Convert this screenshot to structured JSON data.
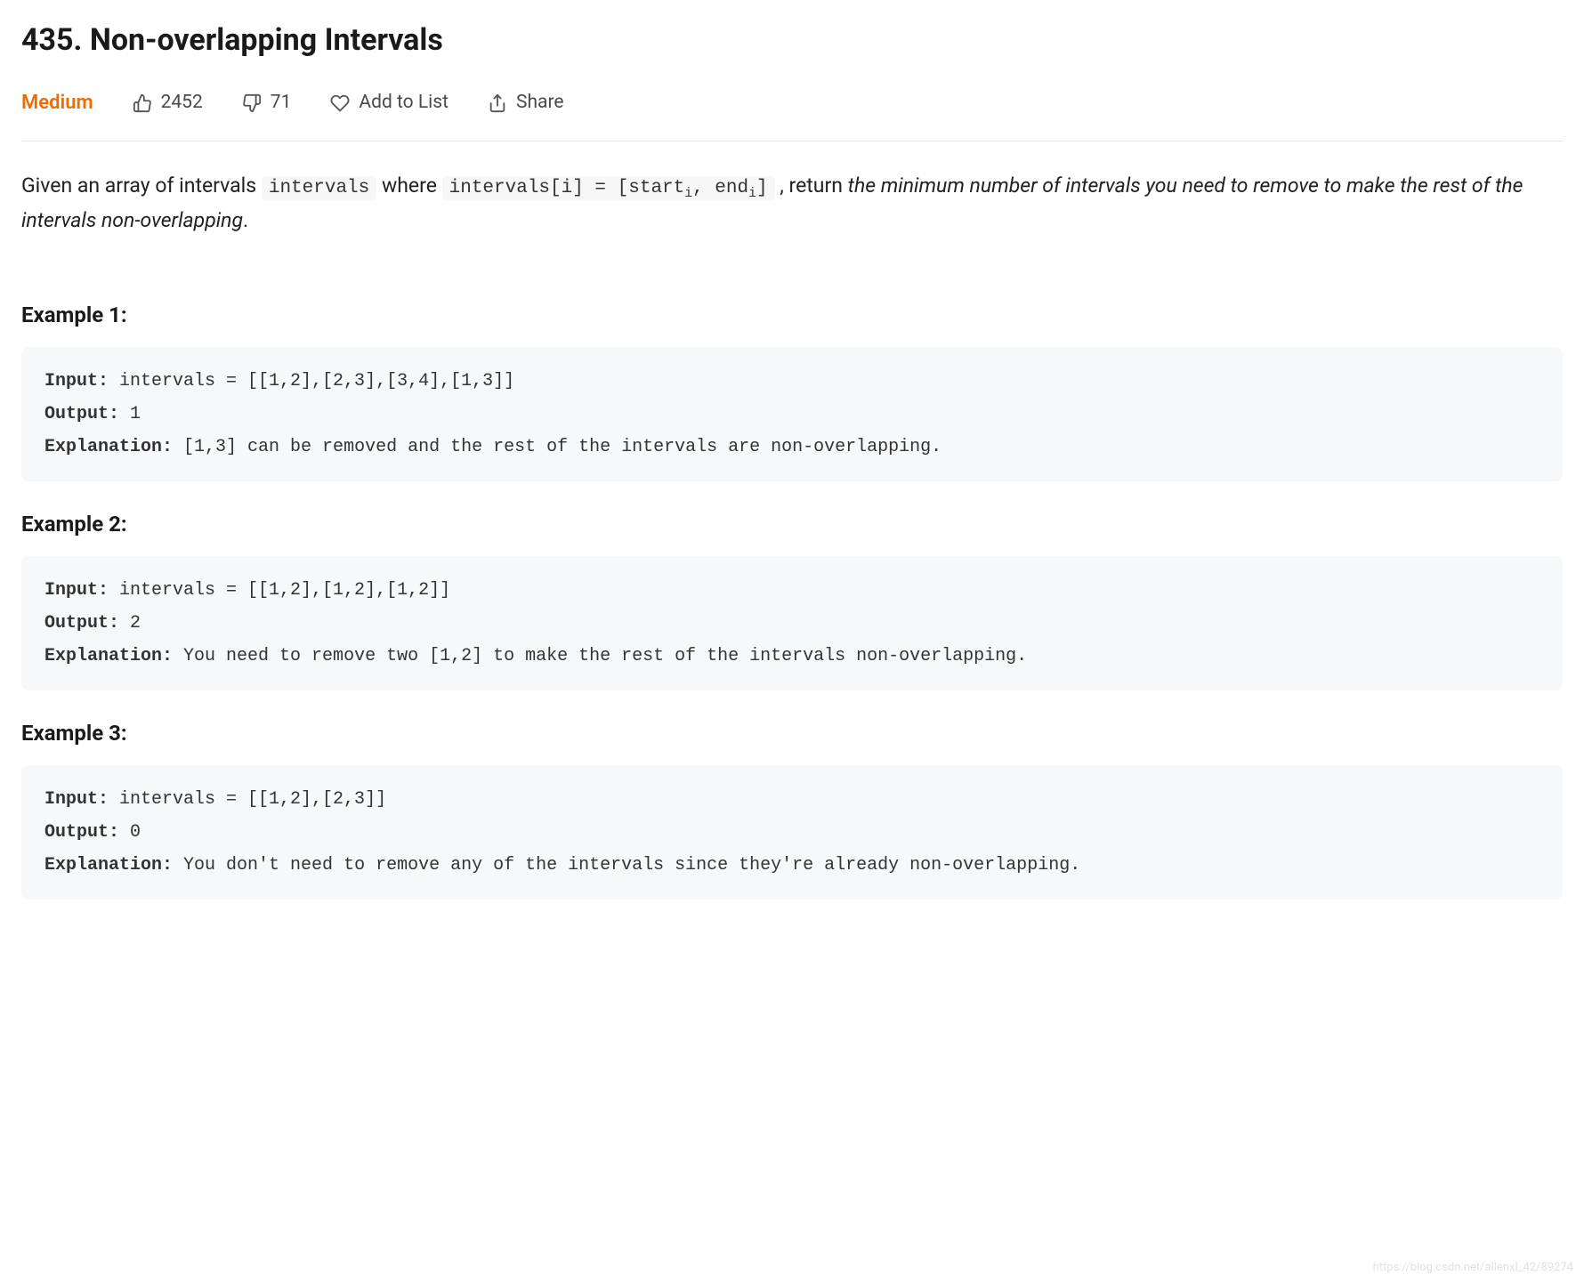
{
  "title": "435. Non-overlapping Intervals",
  "meta": {
    "difficulty": "Medium",
    "upvotes": "2452",
    "downvotes": "71",
    "add_to_list": "Add to List",
    "share": "Share"
  },
  "problem": {
    "lead": "Given an array of intervals ",
    "code1": "intervals",
    "mid1": " where ",
    "code2_pre": "intervals[i] = [start",
    "code2_sub1": "i",
    "code2_mid": ", end",
    "code2_sub2": "i",
    "code2_post": "]",
    "mid2": " , return ",
    "italic": "the minimum number of intervals you need to remove to make the rest of the intervals non-overlapping",
    "end": "."
  },
  "examples": [
    {
      "heading": "Example 1:",
      "input_label": "Input:",
      "input_value": " intervals = [[1,2],[2,3],[3,4],[1,3]]",
      "output_label": "Output:",
      "output_value": " 1",
      "explanation_label": "Explanation:",
      "explanation_value": " [1,3] can be removed and the rest of the intervals are non-overlapping."
    },
    {
      "heading": "Example 2:",
      "input_label": "Input:",
      "input_value": " intervals = [[1,2],[1,2],[1,2]]",
      "output_label": "Output:",
      "output_value": " 2",
      "explanation_label": "Explanation:",
      "explanation_value": " You need to remove two [1,2] to make the rest of the intervals non-overlapping."
    },
    {
      "heading": "Example 3:",
      "input_label": "Input:",
      "input_value": " intervals = [[1,2],[2,3]]",
      "output_label": "Output:",
      "output_value": " 0",
      "explanation_label": "Explanation:",
      "explanation_value": " You don't need to remove any of the intervals since they're already non-overlapping."
    }
  ],
  "watermark": "https://blog.csdn.net/allenxl_42/89274"
}
